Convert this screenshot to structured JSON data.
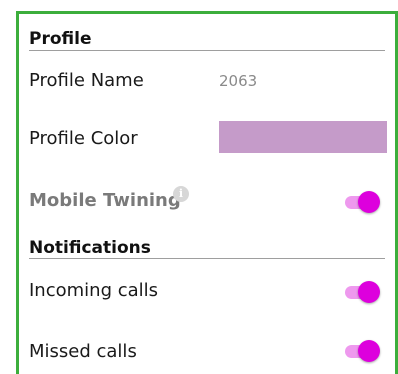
{
  "profile": {
    "section_title": "Profile",
    "name_label": "Profile Name",
    "name_value": "2063",
    "color_label": "Profile Color",
    "color_value": "#c59bc9",
    "mobile_twining_label": "Mobile Twining",
    "mobile_twining_on": true
  },
  "notifications": {
    "section_title": "Notifications",
    "incoming_calls_label": "Incoming calls",
    "incoming_calls_on": true,
    "missed_calls_label": "Missed calls",
    "missed_calls_on": true
  },
  "colors": {
    "accent": "#dd00dd",
    "accent_track": "#ee99ee",
    "frame_border": "#3cae3c"
  },
  "icons": {
    "info": "info-icon"
  }
}
